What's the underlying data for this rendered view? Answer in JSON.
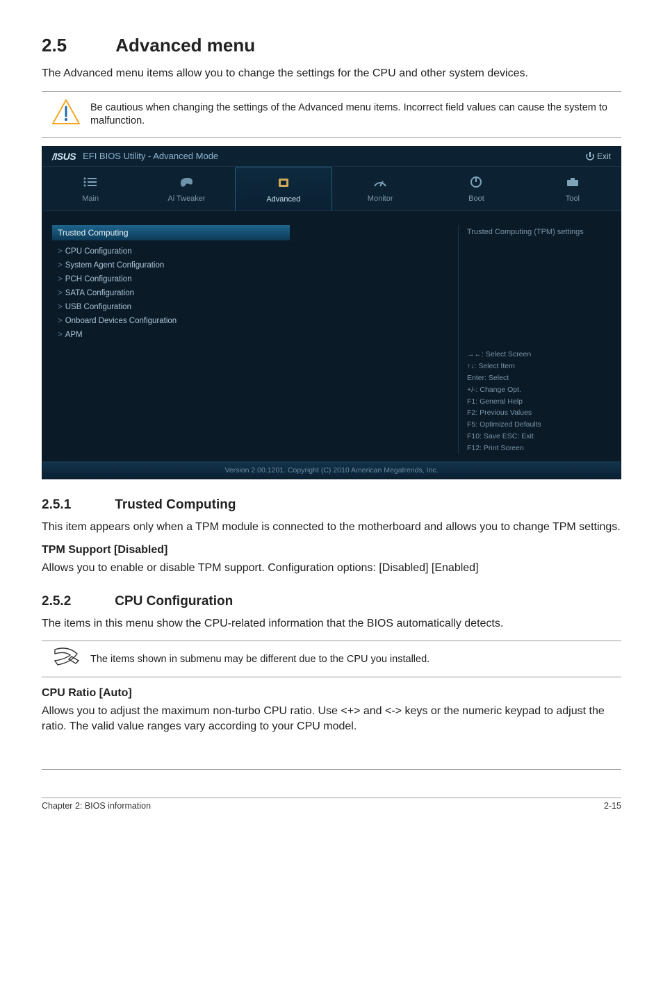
{
  "section_number": "2.5",
  "section_title": "Advanced menu",
  "intro_text": "The Advanced menu items allow you to change the settings for the CPU and other system devices.",
  "caution_text": "Be cautious when changing the settings of the Advanced menu items. Incorrect field values can cause the system to malfunction.",
  "bios": {
    "logo": "/ISUS",
    "title": "EFI BIOS Utility - Advanced Mode",
    "exit_label": "Exit",
    "tabs": {
      "main": "Main",
      "ai_tweaker": "Ai Tweaker",
      "advanced": "Advanced",
      "monitor": "Monitor",
      "boot": "Boot",
      "tool": "Tool"
    },
    "menu": {
      "highlighted": "Trusted Computing",
      "items": [
        "CPU Configuration",
        "System Agent Configuration",
        "PCH Configuration",
        "SATA Configuration",
        "USB Configuration",
        "Onboard Devices Configuration",
        "APM"
      ]
    },
    "help_top": "Trusted Computing (TPM) settings",
    "help_keys": {
      "l1": "→←: Select Screen",
      "l2": "↑↓: Select Item",
      "l3": "Enter: Select",
      "l4": "+/-: Change Opt.",
      "l5": "F1: General Help",
      "l6": "F2: Previous Values",
      "l7": "F5: Optimized Defaults",
      "l8": "F10: Save   ESC: Exit",
      "l9": "F12: Print Screen"
    },
    "footer": "Version 2.00.1201.  Copyright (C) 2010 American Megatrends, Inc."
  },
  "sub1": {
    "num": "2.5.1",
    "title": "Trusted Computing",
    "body": "This item appears only when a TPM module is connected to the motherboard and allows you to change TPM settings.",
    "opt_title": "TPM Support [Disabled]",
    "opt_body": "Allows you to enable or disable TPM support. Configuration options: [Disabled] [Enabled]"
  },
  "sub2": {
    "num": "2.5.2",
    "title": "CPU Configuration",
    "body": "The items in this menu show the CPU-related information that the BIOS automatically detects.",
    "note": "The items shown in submenu may be different due to the CPU you installed.",
    "opt_title": "CPU Ratio [Auto]",
    "opt_body": "Allows you to adjust the maximum non-turbo CPU ratio. Use <+> and <-> keys or the numeric keypad to adjust the ratio. The valid value ranges vary according to your CPU model."
  },
  "footer": {
    "left": "Chapter 2: BIOS information",
    "right": "2-15"
  }
}
